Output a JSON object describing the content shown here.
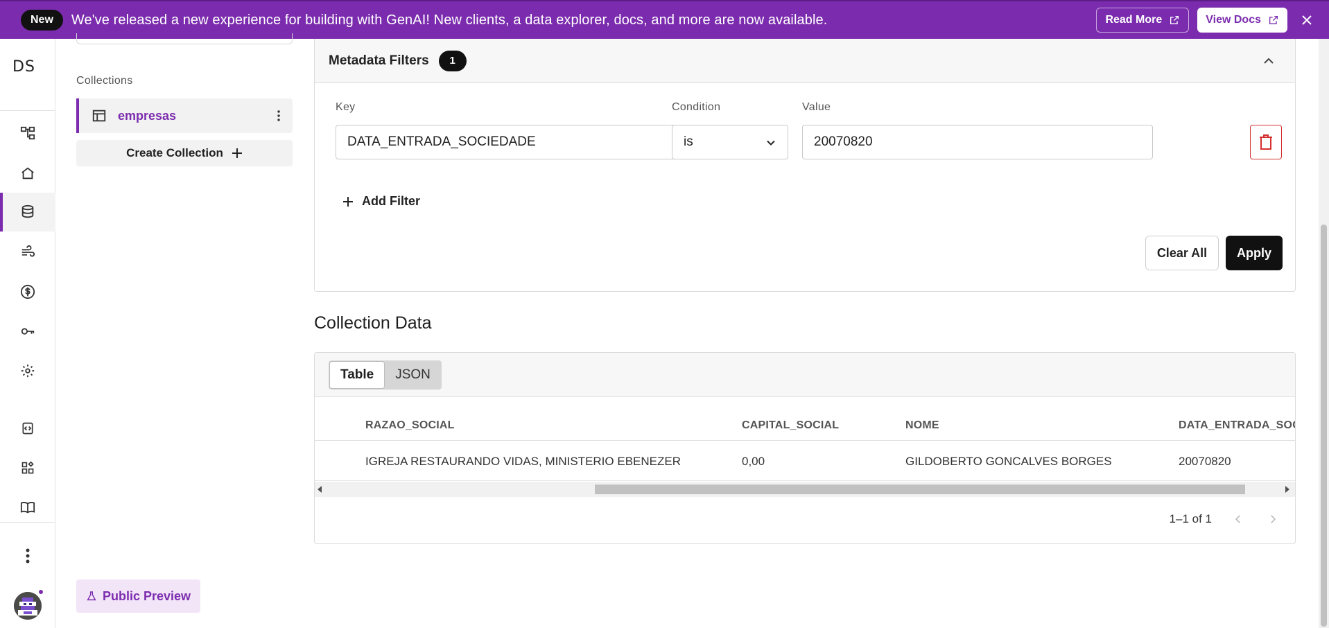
{
  "banner": {
    "new_label": "New",
    "message": "We've released a new experience for building with GenAI! New clients, a data explorer, docs, and more are now available.",
    "read_more": "Read More",
    "view_docs": "View Docs"
  },
  "rail": {
    "logo": "DS",
    "items": [
      "graph-icon",
      "home-icon",
      "database-icon",
      "wind-icon",
      "dollar-icon",
      "key-icon",
      "gear-icon",
      "api-icon",
      "widgets-icon",
      "book-icon"
    ],
    "active": "database-icon"
  },
  "collections": {
    "title": "Collections",
    "items": [
      {
        "name": "empresas"
      }
    ],
    "create_label": "Create Collection",
    "public_preview": "Public Preview"
  },
  "filters": {
    "title": "Metadata Filters",
    "count": "1",
    "key_label": "Key",
    "condition_label": "Condition",
    "value_label": "Value",
    "key_value": "DATA_ENTRADA_SOCIEDADE",
    "condition_value": "is",
    "value_value": "20070820",
    "add_filter": "Add Filter",
    "clear_all": "Clear All",
    "apply": "Apply"
  },
  "collection_data": {
    "title": "Collection Data",
    "views": [
      "Table",
      "JSON"
    ],
    "active_view": "Table",
    "columns": [
      "RAZAO_SOCIAL",
      "CAPITAL_SOCIAL",
      "NOME",
      "DATA_ENTRADA_SOCI"
    ],
    "rows": [
      [
        "IGREJA RESTAURANDO VIDAS, MINISTERIO EBENEZER",
        "0,00",
        "GILDOBERTO GONCALVES BORGES",
        "20070820"
      ]
    ],
    "pagination": "1–1 of 1"
  },
  "colors": {
    "brand": "#7b2cae",
    "danger": "#d32f2f"
  }
}
